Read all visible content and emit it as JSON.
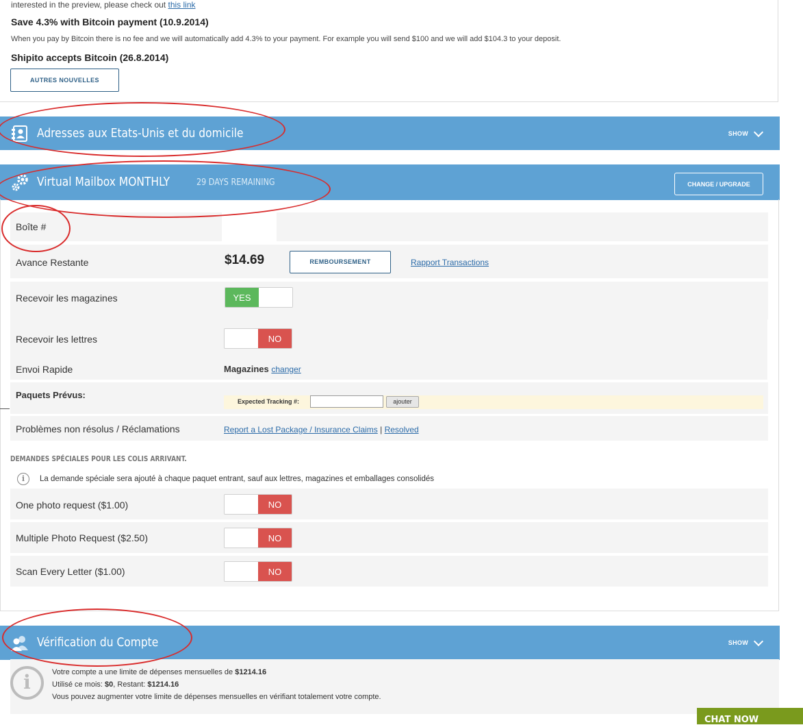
{
  "news": {
    "preview_text": "interested in the preview, please check out",
    "preview_link": "this link",
    "item1_title": "Save 4.3% with Bitcoin payment (10.9.2014)",
    "item1_body": "When you pay by Bitcoin there is no fee and we will automatically add 4.3% to your payment. For example you will send $100 and we will add $104.3 to your deposit.",
    "item2_title": "Shipito accepts Bitcoin (26.8.2014)",
    "more_button": "AUTRES NOUVELLES"
  },
  "addresses": {
    "title": "Adresses aux Etats-Unis et du domicile",
    "show": "SHOW"
  },
  "mailbox": {
    "title": "Virtual Mailbox MONTHLY",
    "remaining": "29 DAYS REMAINING",
    "upgrade_button": "CHANGE / UPGRADE",
    "box_label": "Boîte #",
    "advance_label": "Avance Restante",
    "advance_value": "$14.69",
    "refund_button": "REMBOURSEMENT",
    "transactions_link": "Rapport Transactions",
    "magazines_label": "Recevoir les magazines",
    "magazines_toggle": "YES",
    "letters_label": "Recevoir les lettres",
    "letters_toggle": "NO",
    "fast_label": "Envoi Rapide",
    "fast_value": "Magazines",
    "fast_change": "changer",
    "planned_label": "Paquets Prévus:",
    "tracking_label": "Expected Tracking #:",
    "tracking_value": "",
    "add_button": "ajouter",
    "issues_label": "Problèmes non résolus / Réclamations",
    "lost_link": "Report a Lost Package / Insurance Claims",
    "separator": "|",
    "resolved_link": "Resolved",
    "special_heading": "DEMANDES SPÉCIALES POUR LES COLIS ARRIVANT.",
    "special_info": "La demande spéciale sera ajouté à chaque paquet entrant, sauf aux lettres, magazines et emballages consolidés",
    "special_rows": [
      {
        "label": "One photo request ($1.00)",
        "toggle": "NO"
      },
      {
        "label": "Multiple Photo Request ($2.50)",
        "toggle": "NO"
      },
      {
        "label": "Scan Every Letter ($1.00)",
        "toggle": "NO"
      }
    ]
  },
  "verification": {
    "title": "Vérification du Compte",
    "show": "SHOW",
    "line1_text": "Votre compte a une limite de dépenses mensuelles de ",
    "line1_value": "$1214.16",
    "line2_used_label": "Utilisé ce mois: ",
    "line2_used": "$0",
    "line2_rest_label": ", Restant: ",
    "line2_rest": "$1214.16",
    "line3": "Vous pouvez augmenter votre limite de dépenses mensuelles en vérifiant totalement votre compte."
  },
  "chat": {
    "label": "CHAT NOW"
  },
  "colors": {
    "band": "#5ea2d4",
    "yes": "#5cb85c",
    "no": "#d9534f",
    "chat": "#7a9a1d",
    "annotation": "#d92b2b"
  }
}
